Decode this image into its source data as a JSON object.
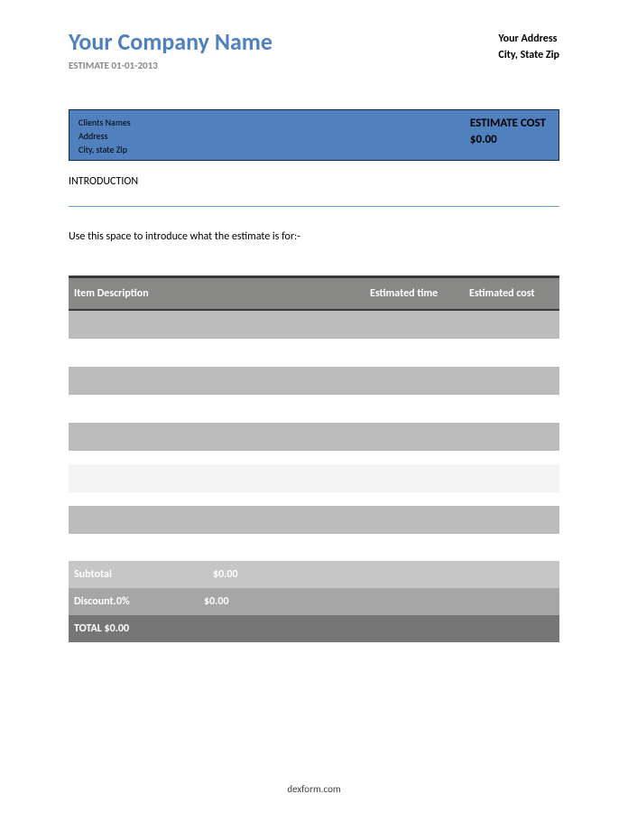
{
  "header": {
    "company": "Your Company Name",
    "estimate_line": "ESTIMATE 01-01-2013",
    "address_line1": "Your Address",
    "address_line2": "City, State Zip"
  },
  "client": {
    "names": "Clients Names",
    "address": "Address",
    "city": "City, state Zip",
    "cost_label": "ESTIMATE COST",
    "cost_value": "$0.00"
  },
  "intro": {
    "label": "INTRODUCTION",
    "text": "Use this space to introduce what the estimate is for:-"
  },
  "table": {
    "col_desc": "Item Description",
    "col_time": "Estimated time",
    "col_cost": "Estimated cost"
  },
  "summary": {
    "subtotal_label": "Subtotal",
    "subtotal_value": "$0.00",
    "discount_label": "Discount.0%",
    "discount_value": "$0.00",
    "total_line": "TOTAL $0.00"
  },
  "footer": "dexform.com"
}
